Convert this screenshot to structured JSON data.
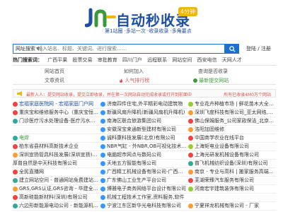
{
  "header": {
    "logo_title": "自动秒收录",
    "logo_badge": "4分钟",
    "slogan": "第1站圈 ·多站一次 ·收录收录 ·多角要点"
  },
  "search": {
    "category": "网址搜索",
    "placeholder": "输入站名、标题、关键词、进行搜索……",
    "login_label": "登陆",
    "register_label": "注册",
    "separator": "/"
  },
  "hot": {
    "label": "热门搜索词：",
    "items": [
      "广西平果",
      "股票交易",
      "审批教育",
      "四川门户",
      "远程联系",
      "网站空间",
      "西安电信",
      "天网人才"
    ]
  },
  "links": {
    "home": "网站首页",
    "join": "如何加入",
    "query": "查询是否收录",
    "news": "文章资讯",
    "top": "人气排行榜",
    "new_sites": "最新提交网站"
  },
  "notice": {
    "text": "最新入人：提交网站收录，提交立即收录，并在第一次网站自动完成收录或打开到前面中",
    "right": "所有已收录4M0万个网站"
  },
  "colors": {
    "brand": "#1f4fa0",
    "accent_blue": "#1f6fd0",
    "red": "#d9534f",
    "green": "#3a9a3a"
  },
  "grid": [
    [
      {
        "text": "宏福家庭医院网 - 宏福家庭门户网",
        "color": "blue",
        "fav": "#e44"
      },
      {
        "text": "济南四件住宅,外平精彩电动建筑物",
        "color": "plain",
        "fav": "#39f"
      },
      {
        "text": "专业花卉种植市场 | 鲜花苗木大全 | 绿化",
        "color": "plain",
        "fav": "#9c3"
      }
    ],
    [
      {
        "text": "重庆宝和维修服务中心（重庆宝恒售后",
        "color": "plain",
        "fav": "#e44"
      },
      {
        "text": "新疆风扇升降机(新疆风扇机升降机)",
        "color": "plain",
        "fav": "#39f"
      },
      {
        "text": "深圳飞度科技有限公司_亚太网络,软件开",
        "color": "plain",
        "fav": "#f93"
      }
    ],
    [
      {
        "text": "门诊医疗污水处理设备-医疗污水处理一体",
        "color": "plain",
        "fav": "#3a9"
      },
      {
        "text": "南海区联合旅游集团公司",
        "color": "plain",
        "fav": "#39f"
      },
      {
        "text": "佛山保姆服务_公司家政保洁_北京保洁公",
        "color": "plain",
        "fav": "#e44"
      }
    ],
    [
      {
        "text": "",
        "color": "plain",
        "fav": ""
      },
      {
        "text": "安徽深宝来通新型建材有限公司",
        "color": "plain",
        "fav": "#39f"
      },
      {
        "text": "洛阳加固维修",
        "color": "plain",
        "fav": "#f93"
      }
    ],
    [
      {
        "text": "电焊",
        "color": "green",
        "fav": "#3a9"
      },
      {
        "text": "诚科康科技发展(北京)有限公司",
        "color": "plain",
        "fav": "#39f"
      },
      {
        "text": "中国商学农业在线平台",
        "color": "plain",
        "fav": "#e44"
      }
    ],
    [
      {
        "text": "柏东省县材料高新技术企业",
        "color": "plain",
        "fav": "#e44"
      },
      {
        "text": "NBR气缸 - 外NBR,OB可视化技术企业",
        "color": "plain",
        "fav": "#39f"
      },
      {
        "text": "上海矩电业设备有限公司",
        "color": "plain",
        "fav": "#9c3"
      }
    ],
    [
      {
        "text": "深圳宣扬管具科技发展(深圳宣扬)有限",
        "color": "plain",
        "fav": "#f93"
      },
      {
        "text": "电脑超市网点与数码公司",
        "color": "plain",
        "fav": "#39f"
      },
      {
        "text": "上海光研发机械设备有限公司",
        "color": "plain",
        "fav": "#e44"
      }
    ],
    [
      {
        "text": "厚普自然是中天科技有限公司",
        "color": "plain",
        "fav": ""
      },
      {
        "text": "天地五方智能有限公司",
        "color": "plain",
        "fav": "#39f"
      },
      {
        "text": "普飞机械纺织设备(深圳)有限公司",
        "color": "plain",
        "fav": "#3a9"
      }
    ],
    [
      {
        "text": "全民直播网",
        "color": "plain",
        "fav": "#e44"
      },
      {
        "text": "广西精工机械设备有限公司-广西精科",
        "color": "plain",
        "fav": "#39f"
      },
      {
        "text": "南京 - 专业与高科 | 搬家服务高端公司",
        "color": "plain",
        "fav": "#f93"
      }
    ],
    [
      {
        "text": "建立网站空间 - 普通网站免费建站,速度",
        "color": "plain",
        "fav": "#3a9"
      },
      {
        "text": "广东佛山工业生产平台公司",
        "color": "plain",
        "fav": "#39f"
      },
      {
        "text": "芜湖荣臻汽车服务有限公司",
        "color": "plain",
        "fav": "#e44"
      }
    ],
    [
      {
        "text": "GRS,GRS认证,GRS咨询 - 华建全面网络技",
        "color": "plain",
        "fav": "#f93"
      },
      {
        "text": "博雅电子商务网络平台设计有限公司",
        "color": "plain",
        "fav": "#39f"
      },
      {
        "text": "河南宏宇建筑装饰有限公司",
        "color": "plain",
        "fav": "#9c3"
      }
    ],
    [
      {
        "text": "高新硅能新材料(深圳)有限公司",
        "color": "plain",
        "fav": "#e44"
      },
      {
        "text": "机械工程技术工作室,资料服务,软件",
        "color": "plain",
        "fav": "#39f"
      },
      {
        "text": "",
        "color": "plain",
        "fav": ""
      }
    ],
    [
      {
        "text": "六边形新能源电动公司 - 新能源机床服务",
        "color": "plain",
        "fav": "#3a9"
      },
      {
        "text": "宁波江东区新华光电科技有限公司",
        "color": "plain",
        "fav": "#39f"
      },
      {
        "text": "宁夏祥龙机械有限公司 - 厂家",
        "color": "plain",
        "fav": "#f93"
      }
    ]
  ]
}
